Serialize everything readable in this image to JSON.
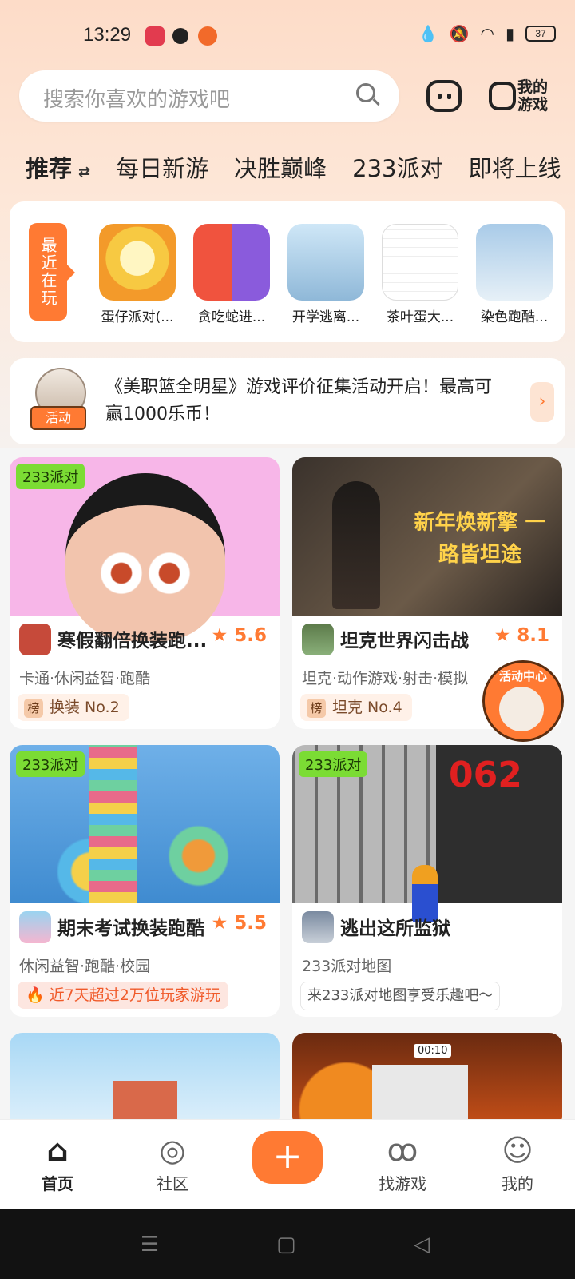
{
  "status_bar": {
    "time": "13:29",
    "battery": "37"
  },
  "search": {
    "placeholder": "搜索你喜欢的游戏吧"
  },
  "header": {
    "my_games_label": "我的游戏"
  },
  "tabs": [
    {
      "label": "推荐",
      "active": true
    },
    {
      "label": "每日新游"
    },
    {
      "label": "决胜巅峰"
    },
    {
      "label": "233派对"
    },
    {
      "label": "即将上线"
    }
  ],
  "recent": {
    "label": "最近在玩",
    "games": [
      {
        "name": "蛋仔派对(..."
      },
      {
        "name": "贪吃蛇进..."
      },
      {
        "name": "开学逃离..."
      },
      {
        "name": "茶叶蛋大..."
      },
      {
        "name": "染色跑酷..."
      }
    ]
  },
  "activity": {
    "badge": "活动",
    "text": "《美职篮全明星》游戏评价征集活动开启！最高可赢1000乐币！"
  },
  "cards": [
    {
      "tag": "233派对",
      "name": "寒假翻倍换装跑...",
      "rating": "5.6",
      "tags": "卡通·休闲益智·跑酷",
      "rank_badge": "榜",
      "rank": "换装 No.2"
    },
    {
      "tag": "",
      "name": "坦克世界闪击战",
      "rating": "8.1",
      "tags": "坦克·动作游戏·射击·模拟",
      "rank_badge": "榜",
      "rank": "坦克 No.4",
      "cover_text": "新年焕新擎 一路皆坦途"
    },
    {
      "tag": "233派对",
      "name": "期末考试换装跑酷",
      "rating": "5.5",
      "tags": "休闲益智·跑酷·校园",
      "hot": "近7天超过2万位玩家游玩"
    },
    {
      "tag": "233派对",
      "name": "逃出这所监狱",
      "rating": "",
      "tags": "233派对地图",
      "map_tag": "来233派对地图享受乐趣吧～",
      "cover_text": "062"
    },
    {
      "tag": "",
      "name": ""
    },
    {
      "tag": "",
      "name": "",
      "cover_text": "00:10"
    }
  ],
  "float_center": {
    "label": "活动中心"
  },
  "bottom_nav": [
    {
      "label": "首页",
      "active": true
    },
    {
      "label": "社区"
    },
    {
      "label": "找游戏"
    },
    {
      "label": "我的"
    }
  ],
  "colors": {
    "accent": "#ff7a33",
    "party_tag": "#7bdc34"
  }
}
